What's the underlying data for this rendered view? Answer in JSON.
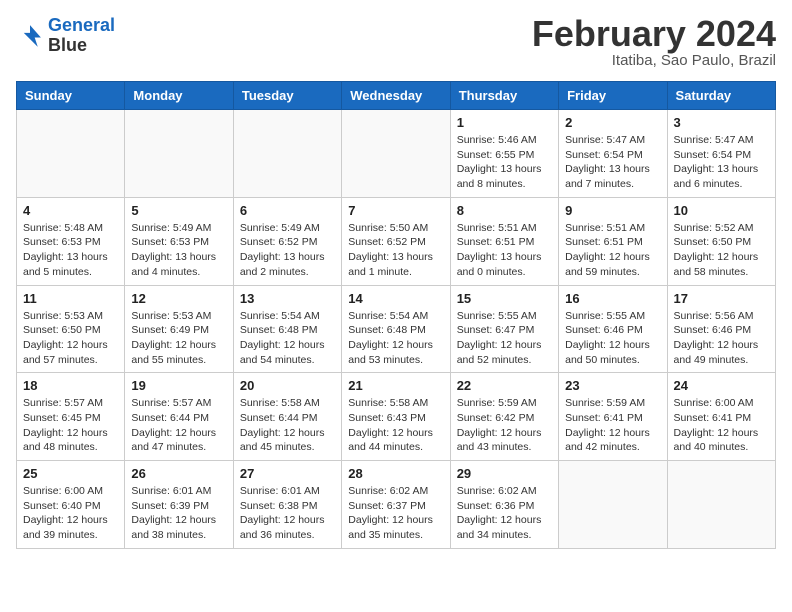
{
  "logo": {
    "line1": "General",
    "line2": "Blue"
  },
  "title": "February 2024",
  "location": "Itatiba, Sao Paulo, Brazil",
  "days_of_week": [
    "Sunday",
    "Monday",
    "Tuesday",
    "Wednesday",
    "Thursday",
    "Friday",
    "Saturday"
  ],
  "weeks": [
    [
      {
        "day": "",
        "info": ""
      },
      {
        "day": "",
        "info": ""
      },
      {
        "day": "",
        "info": ""
      },
      {
        "day": "",
        "info": ""
      },
      {
        "day": "1",
        "info": "Sunrise: 5:46 AM\nSunset: 6:55 PM\nDaylight: 13 hours\nand 8 minutes."
      },
      {
        "day": "2",
        "info": "Sunrise: 5:47 AM\nSunset: 6:54 PM\nDaylight: 13 hours\nand 7 minutes."
      },
      {
        "day": "3",
        "info": "Sunrise: 5:47 AM\nSunset: 6:54 PM\nDaylight: 13 hours\nand 6 minutes."
      }
    ],
    [
      {
        "day": "4",
        "info": "Sunrise: 5:48 AM\nSunset: 6:53 PM\nDaylight: 13 hours\nand 5 minutes."
      },
      {
        "day": "5",
        "info": "Sunrise: 5:49 AM\nSunset: 6:53 PM\nDaylight: 13 hours\nand 4 minutes."
      },
      {
        "day": "6",
        "info": "Sunrise: 5:49 AM\nSunset: 6:52 PM\nDaylight: 13 hours\nand 2 minutes."
      },
      {
        "day": "7",
        "info": "Sunrise: 5:50 AM\nSunset: 6:52 PM\nDaylight: 13 hours\nand 1 minute."
      },
      {
        "day": "8",
        "info": "Sunrise: 5:51 AM\nSunset: 6:51 PM\nDaylight: 13 hours\nand 0 minutes."
      },
      {
        "day": "9",
        "info": "Sunrise: 5:51 AM\nSunset: 6:51 PM\nDaylight: 12 hours\nand 59 minutes."
      },
      {
        "day": "10",
        "info": "Sunrise: 5:52 AM\nSunset: 6:50 PM\nDaylight: 12 hours\nand 58 minutes."
      }
    ],
    [
      {
        "day": "11",
        "info": "Sunrise: 5:53 AM\nSunset: 6:50 PM\nDaylight: 12 hours\nand 57 minutes."
      },
      {
        "day": "12",
        "info": "Sunrise: 5:53 AM\nSunset: 6:49 PM\nDaylight: 12 hours\nand 55 minutes."
      },
      {
        "day": "13",
        "info": "Sunrise: 5:54 AM\nSunset: 6:48 PM\nDaylight: 12 hours\nand 54 minutes."
      },
      {
        "day": "14",
        "info": "Sunrise: 5:54 AM\nSunset: 6:48 PM\nDaylight: 12 hours\nand 53 minutes."
      },
      {
        "day": "15",
        "info": "Sunrise: 5:55 AM\nSunset: 6:47 PM\nDaylight: 12 hours\nand 52 minutes."
      },
      {
        "day": "16",
        "info": "Sunrise: 5:55 AM\nSunset: 6:46 PM\nDaylight: 12 hours\nand 50 minutes."
      },
      {
        "day": "17",
        "info": "Sunrise: 5:56 AM\nSunset: 6:46 PM\nDaylight: 12 hours\nand 49 minutes."
      }
    ],
    [
      {
        "day": "18",
        "info": "Sunrise: 5:57 AM\nSunset: 6:45 PM\nDaylight: 12 hours\nand 48 minutes."
      },
      {
        "day": "19",
        "info": "Sunrise: 5:57 AM\nSunset: 6:44 PM\nDaylight: 12 hours\nand 47 minutes."
      },
      {
        "day": "20",
        "info": "Sunrise: 5:58 AM\nSunset: 6:44 PM\nDaylight: 12 hours\nand 45 minutes."
      },
      {
        "day": "21",
        "info": "Sunrise: 5:58 AM\nSunset: 6:43 PM\nDaylight: 12 hours\nand 44 minutes."
      },
      {
        "day": "22",
        "info": "Sunrise: 5:59 AM\nSunset: 6:42 PM\nDaylight: 12 hours\nand 43 minutes."
      },
      {
        "day": "23",
        "info": "Sunrise: 5:59 AM\nSunset: 6:41 PM\nDaylight: 12 hours\nand 42 minutes."
      },
      {
        "day": "24",
        "info": "Sunrise: 6:00 AM\nSunset: 6:41 PM\nDaylight: 12 hours\nand 40 minutes."
      }
    ],
    [
      {
        "day": "25",
        "info": "Sunrise: 6:00 AM\nSunset: 6:40 PM\nDaylight: 12 hours\nand 39 minutes."
      },
      {
        "day": "26",
        "info": "Sunrise: 6:01 AM\nSunset: 6:39 PM\nDaylight: 12 hours\nand 38 minutes."
      },
      {
        "day": "27",
        "info": "Sunrise: 6:01 AM\nSunset: 6:38 PM\nDaylight: 12 hours\nand 36 minutes."
      },
      {
        "day": "28",
        "info": "Sunrise: 6:02 AM\nSunset: 6:37 PM\nDaylight: 12 hours\nand 35 minutes."
      },
      {
        "day": "29",
        "info": "Sunrise: 6:02 AM\nSunset: 6:36 PM\nDaylight: 12 hours\nand 34 minutes."
      },
      {
        "day": "",
        "info": ""
      },
      {
        "day": "",
        "info": ""
      }
    ]
  ]
}
